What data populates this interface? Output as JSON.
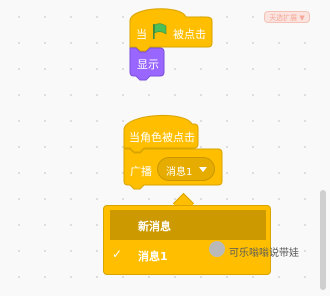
{
  "palette": {
    "control_block": "#ffbf00",
    "looks_block": "#9966ff",
    "flag_green": "#4cbf56",
    "menu_highlight": "#cc9900"
  },
  "top_badge": {
    "label": "天选扩展 ▼"
  },
  "hat_block_1": {
    "label_when": "当",
    "flag_icon": "green-flag-icon",
    "label_clicked": "被点击"
  },
  "show_block": {
    "label": "显示"
  },
  "hat_block_2": {
    "label": "当角色被点击"
  },
  "broadcast_block": {
    "label": "广播",
    "dropdown_value": "消息1"
  },
  "dropdown_menu": {
    "items": [
      {
        "label": "新消息",
        "selected": false
      },
      {
        "label": "消息1",
        "selected": true
      }
    ],
    "check_mark": "✓"
  },
  "watermark": {
    "text": "可乐嗡嗡说带娃"
  }
}
